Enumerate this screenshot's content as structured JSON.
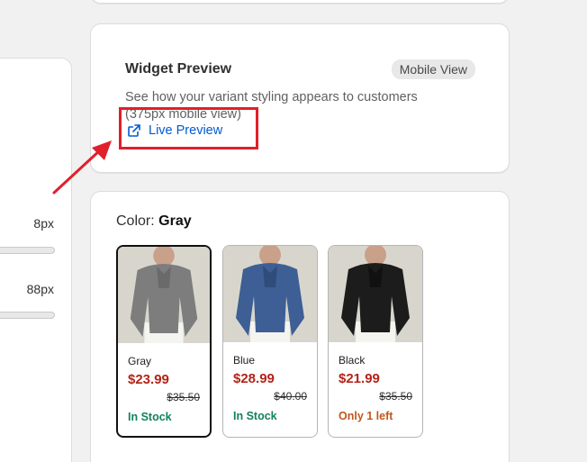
{
  "left_panel": {
    "slider1_value": "8px",
    "slider2_value": "88px"
  },
  "preview": {
    "title": "Widget Preview",
    "badge": "Mobile View",
    "description": "See how your variant styling appears to customers (375px mobile view)",
    "live_link": "Live Preview",
    "link_color": "#005bd3"
  },
  "variants": {
    "color_label": "Color:",
    "selected_color": "Gray",
    "items": [
      {
        "name": "Gray",
        "price": "$23.99",
        "old_price": "$35.50",
        "stock": "In Stock",
        "shirt_color": "#7d7d7d"
      },
      {
        "name": "Blue",
        "price": "$28.99",
        "old_price": "$40.00",
        "stock": "In Stock",
        "shirt_color": "#3d5f95"
      },
      {
        "name": "Black",
        "price": "$21.99",
        "old_price": "$35.50",
        "stock": "Only 1 left",
        "shirt_color": "#1c1c1c"
      }
    ]
  },
  "annotation": {
    "color": "#e0202a"
  }
}
